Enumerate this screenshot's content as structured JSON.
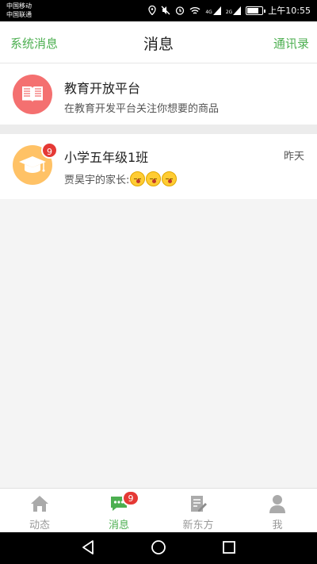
{
  "status_bar": {
    "carrier_1": "中国移动",
    "carrier_2": "中国联通",
    "time": "上午10:55",
    "net_1": "4G",
    "net_2": "2G",
    "battery_level": 0.85
  },
  "header": {
    "left_label": "系统消息",
    "title": "消息",
    "right_label": "通讯录"
  },
  "messages": [
    {
      "title": "教育开放平台",
      "subtitle": "在教育开发平台关注你想要的商品",
      "icon": "book-icon",
      "avatar_color": "#f47070"
    },
    {
      "title": "小学五年级1班",
      "subtitle": "贾昊宇的家长:",
      "time": "昨天",
      "badge": "9",
      "icon": "graduation-cap-icon",
      "avatar_color": "#ffc266"
    }
  ],
  "tabs": [
    {
      "label": "动态",
      "icon": "home-icon",
      "active": false
    },
    {
      "label": "消息",
      "icon": "chat-icon",
      "active": true,
      "badge": "9"
    },
    {
      "label": "新东方",
      "icon": "edit-document-icon",
      "active": false
    },
    {
      "label": "我",
      "icon": "user-icon",
      "active": false
    }
  ],
  "colors": {
    "accent": "#4caf50",
    "badge": "#e53935"
  }
}
